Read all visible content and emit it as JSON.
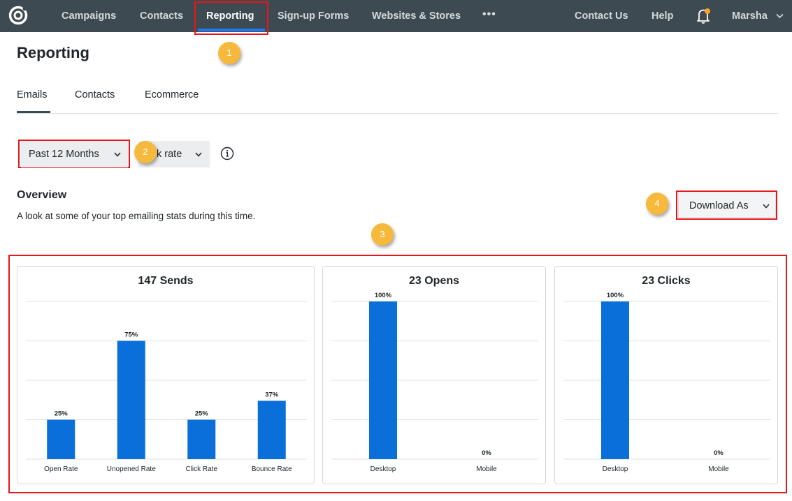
{
  "nav": {
    "items": [
      "Campaigns",
      "Contacts",
      "Reporting",
      "Sign-up Forms",
      "Websites & Stores"
    ],
    "more": "•••",
    "contact": "Contact Us",
    "help": "Help",
    "user": "Marsha",
    "active": "Reporting"
  },
  "page": {
    "title": "Reporting"
  },
  "tabs": [
    "Emails",
    "Contacts",
    "Ecommerce"
  ],
  "active_tab": "Emails",
  "filters": {
    "date_range": "Past 12 Months",
    "metric": "k rate"
  },
  "overview": {
    "title": "Overview",
    "description": "A look at some of your top emailing stats during this time."
  },
  "download": {
    "label": "Download As"
  },
  "markers": [
    "1",
    "2",
    "3",
    "4"
  ],
  "colors": {
    "nav_bg": "#3d4a52",
    "accent": "#1d7cf2",
    "bar": "#0a6fd8",
    "highlight": "#e3171c",
    "marker": "#f6b93b"
  },
  "chart_data": [
    {
      "type": "bar",
      "title": "147 Sends",
      "categories": [
        "Open Rate",
        "Unopened Rate",
        "Click Rate",
        "Bounce Rate"
      ],
      "values": [
        25,
        75,
        25,
        37
      ],
      "value_labels": [
        "25%",
        "75%",
        "25%",
        "37%"
      ],
      "ylim": [
        0,
        100
      ],
      "grid": true
    },
    {
      "type": "bar",
      "title": "23 Opens",
      "categories": [
        "Desktop",
        "Mobile"
      ],
      "values": [
        100,
        0
      ],
      "value_labels": [
        "100%",
        "0%"
      ],
      "ylim": [
        0,
        100
      ],
      "grid": true
    },
    {
      "type": "bar",
      "title": "23 Clicks",
      "categories": [
        "Desktop",
        "Mobile"
      ],
      "values": [
        100,
        0
      ],
      "value_labels": [
        "100%",
        "0%"
      ],
      "ylim": [
        0,
        100
      ],
      "grid": true
    }
  ]
}
